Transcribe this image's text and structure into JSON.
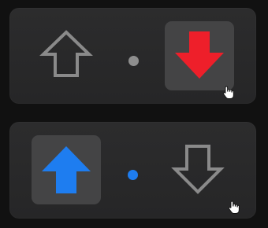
{
  "colors": {
    "page_bg": "#111111",
    "panel_bg": "#2a2a2b",
    "selected_bg": "#444445",
    "outline_gray": "#8a8a8a",
    "down_active": "#ee1f2a",
    "up_active": "#1e7df0",
    "dot_neutral": "#8e8e8e",
    "dot_blue": "#1e7df0"
  },
  "panels": [
    {
      "up": {
        "icon": "up-arrow-outline-icon",
        "state": "unselected"
      },
      "down": {
        "icon": "down-arrow-filled-icon",
        "state": "selected"
      },
      "indicator": "neutral"
    },
    {
      "up": {
        "icon": "up-arrow-filled-icon",
        "state": "selected"
      },
      "down": {
        "icon": "down-arrow-outline-icon",
        "state": "unselected"
      },
      "indicator": "blue"
    }
  ]
}
